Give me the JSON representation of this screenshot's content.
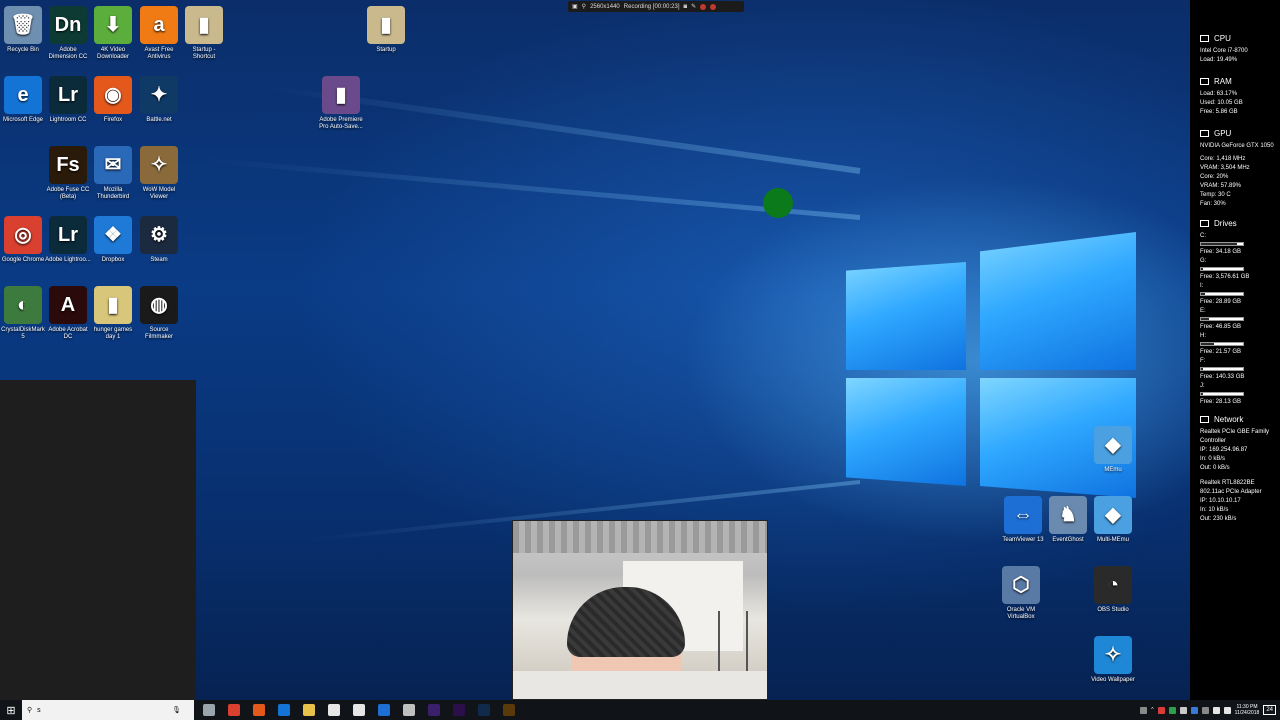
{
  "recording_bar": {
    "resolution": "2560x1440",
    "status": "Recording [00:00:23]"
  },
  "desktop_icons": [
    {
      "label": "Recycle Bin",
      "glyph": "🗑",
      "color": "#6f8fb0"
    },
    {
      "label": "Adobe Dimension CC",
      "glyph": "Dn",
      "color": "#0d3b33"
    },
    {
      "label": "4K Video Downloader",
      "glyph": "⬇",
      "color": "#5cae3c"
    },
    {
      "label": "Avast Free Antivirus",
      "glyph": "a",
      "color": "#f07a13"
    },
    {
      "label": "Startup - Shortcut",
      "glyph": "▮",
      "color": "#c9b98d"
    },
    {
      "label": "Startup",
      "glyph": "▮",
      "color": "#c9b98d"
    },
    {
      "label": "Microsoft Edge",
      "glyph": "e",
      "color": "#1474d6"
    },
    {
      "label": "Lightroom CC",
      "glyph": "Lr",
      "color": "#0b2b3a"
    },
    {
      "label": "Firefox",
      "glyph": "◉",
      "color": "#e5581c"
    },
    {
      "label": "Battle.net",
      "glyph": "✦",
      "color": "#0f3a66"
    },
    {
      "label": "Adobe Premiere Pro Auto-Save...",
      "glyph": "▮",
      "color": "#6a4a8a"
    },
    {
      "label": "Adobe Fuse CC (Beta)",
      "glyph": "Fs",
      "color": "#2a1a0a"
    },
    {
      "label": "Mozilla Thunderbird",
      "glyph": "✉",
      "color": "#2a68b8"
    },
    {
      "label": "WoW Model Viewer",
      "glyph": "✧",
      "color": "#8a6a3a"
    },
    {
      "label": "Google Chrome",
      "glyph": "◎",
      "color": "#d9402f"
    },
    {
      "label": "Adobe Lightroo...",
      "glyph": "Lr",
      "color": "#0b2b3a"
    },
    {
      "label": "Dropbox",
      "glyph": "❖",
      "color": "#1e7ad6"
    },
    {
      "label": "Steam",
      "glyph": "⚙",
      "color": "#1b2a3f"
    },
    {
      "label": "CrystalDiskMark 5",
      "glyph": "◐",
      "color": "#3d7a3d"
    },
    {
      "label": "Adobe Acrobat DC",
      "glyph": "A",
      "color": "#2a0a0a"
    },
    {
      "label": "hunger games day 1",
      "glyph": "▮",
      "color": "#d8c67a"
    },
    {
      "label": "Source Filmmaker",
      "glyph": "◍",
      "color": "#1a1a1a"
    },
    {
      "label": "MEmu",
      "glyph": "◆",
      "color": "#4aa0e0"
    },
    {
      "label": "TeamViewer 13",
      "glyph": "⇔",
      "color": "#1d6fd6"
    },
    {
      "label": "EventGhost",
      "glyph": "♞",
      "color": "#6a8ab0"
    },
    {
      "label": "Multi-MEmu",
      "glyph": "◆",
      "color": "#4aa0e0"
    },
    {
      "label": "Oracle VM VirtualBox",
      "glyph": "⬡",
      "color": "#5a7aa6"
    },
    {
      "label": "OBS Studio",
      "glyph": "◔",
      "color": "#2a2a2a"
    },
    {
      "label": "Video Wallpaper",
      "glyph": "✧",
      "color": "#1e88d6"
    }
  ],
  "sidebar": {
    "cpu": {
      "title": "CPU",
      "model": "Intel Core i7-8700",
      "load": "Load: 19.49%"
    },
    "ram": {
      "title": "RAM",
      "load": "Load: 63.17%",
      "used": "Used: 10.05 GB",
      "free": "Free: 5.86 GB"
    },
    "gpu": {
      "title": "GPU",
      "model": "NVIDIA GeForce GTX 1050",
      "core": "Core: 1,418 MHz",
      "vram": "VRAM: 3,504 MHz",
      "core_load": "Core: 20%",
      "vram_load": "VRAM: 57.89%",
      "temp": "Temp: 30 C",
      "fan": "Fan: 30%"
    },
    "drives": {
      "title": "Drives",
      "items": [
        {
          "letter": "C:",
          "free": "Free: 34.18 GB",
          "used_fraction": 0.85
        },
        {
          "letter": "G:",
          "free": "Free: 3,576.61 GB",
          "used_fraction": 0.05
        },
        {
          "letter": "I:",
          "free": "Free: 28.89 GB",
          "used_fraction": 0.1
        },
        {
          "letter": "E:",
          "free": "Free: 46.85 GB",
          "used_fraction": 0.2
        },
        {
          "letter": "H:",
          "free": "Free: 21.57 GB",
          "used_fraction": 0.3
        },
        {
          "letter": "F:",
          "free": "Free: 140.33 GB",
          "used_fraction": 0.05
        },
        {
          "letter": "J:",
          "free": "Free: 28.13 GB",
          "used_fraction": 0.05
        }
      ]
    },
    "network": {
      "title": "Network",
      "adapter1": {
        "name": "Realtek PCIe GBE Family Controller",
        "ip": "IP: 169.254.96.87",
        "in": "In: 0 kB/s",
        "out": "Out: 0 kB/s"
      },
      "adapter2": {
        "name": "Realtek RTL8822BE 802.11ac PCIe Adapter",
        "ip": "IP: 10.10.10.17",
        "in": "In: 10 kB/s",
        "out": "Out: 230 kB/s"
      }
    }
  },
  "taskbar": {
    "search_value": "s",
    "apps": [
      {
        "name": "task-view-icon",
        "color": "#9aa4ad"
      },
      {
        "name": "chrome-icon",
        "color": "#d9402f"
      },
      {
        "name": "firefox-icon",
        "color": "#e5581c"
      },
      {
        "name": "edge-icon",
        "color": "#1474d6"
      },
      {
        "name": "file-explorer-icon",
        "color": "#e8c14a"
      },
      {
        "name": "store-icon",
        "color": "#e6e6e6"
      },
      {
        "name": "mail-icon",
        "color": "#e6e6e6"
      },
      {
        "name": "teamviewer-icon",
        "color": "#1d6fd6"
      },
      {
        "name": "settings-icon",
        "color": "#bfbfbf"
      },
      {
        "name": "after-effects-icon",
        "color": "#3a1f6a"
      },
      {
        "name": "premiere-icon",
        "color": "#2a0f4a"
      },
      {
        "name": "photoshop-icon",
        "color": "#0f2a4a"
      },
      {
        "name": "bridge-icon",
        "color": "#5a3a0a"
      }
    ],
    "clock_time": "11:30 PM",
    "clock_date": "11/24/2018",
    "notification_count": "24"
  }
}
